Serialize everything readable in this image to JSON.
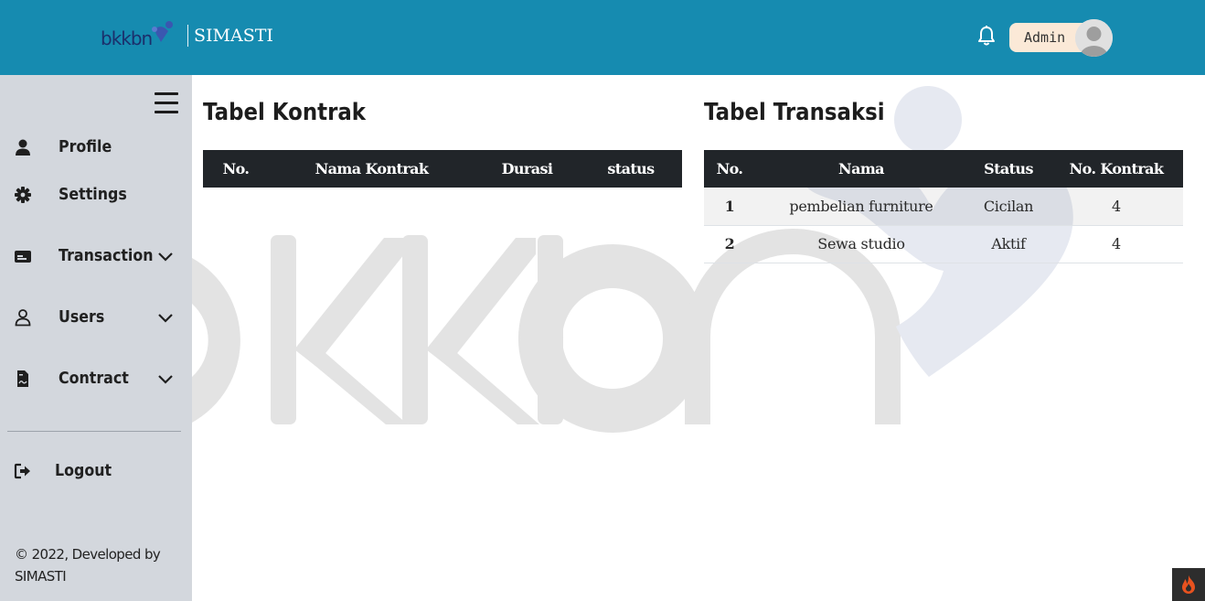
{
  "header": {
    "logo_text": "bkkbn",
    "app_name": "SIMASTI",
    "user_name": "Admin",
    "colors": {
      "bar": "#168bb0",
      "pill": "#fbe9d7"
    }
  },
  "sidebar": {
    "items": [
      {
        "label": "Profile",
        "icon": "user-icon"
      },
      {
        "label": "Settings",
        "icon": "gear-icon"
      },
      {
        "label": "Transaction",
        "icon": "card-icon",
        "expandable": true
      },
      {
        "label": "Users",
        "icon": "user-outline-icon",
        "expandable": true
      },
      {
        "label": "Contract",
        "icon": "file-contract-icon",
        "expandable": true
      }
    ],
    "logout_label": "Logout",
    "footer": "© 2022, Developed by SIMASTI"
  },
  "kontrak": {
    "title": "Tabel Kontrak",
    "headers": [
      "No.",
      "Nama Kontrak",
      "Durasi",
      "status"
    ],
    "rows": []
  },
  "transaksi": {
    "title": "Tabel Transaksi",
    "headers": [
      "No.",
      "Nama",
      "Status",
      "No. Kontrak"
    ],
    "rows": [
      {
        "no": "1",
        "nama": "pembelian furniture",
        "status": "Cicilan",
        "kontrak": "4"
      },
      {
        "no": "2",
        "nama": "Sewa studio",
        "status": "Aktif",
        "kontrak": "4"
      }
    ]
  }
}
